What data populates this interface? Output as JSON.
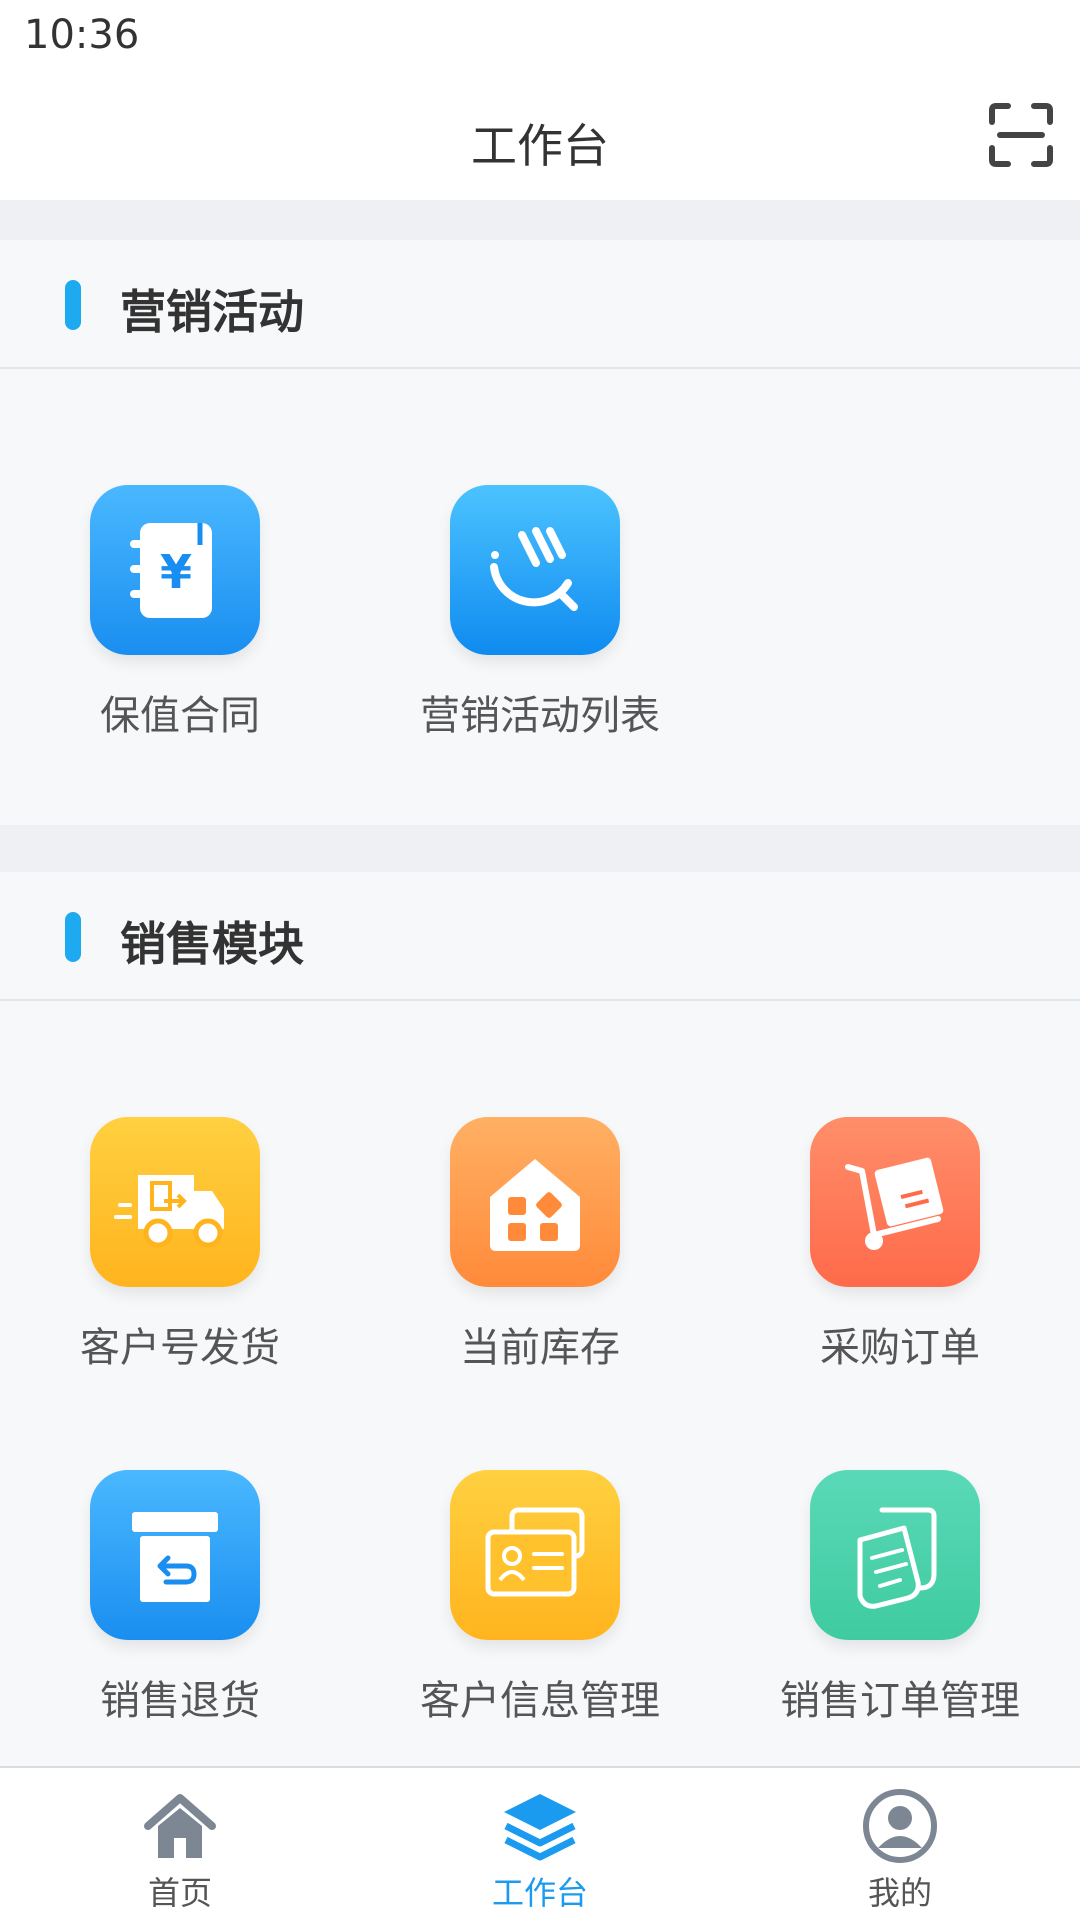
{
  "status_bar": {
    "time": "10:36"
  },
  "header": {
    "title": "工作台",
    "scan_icon": "scan-icon"
  },
  "sections": [
    {
      "title": "营销活动",
      "items": [
        {
          "label": "保值合同",
          "icon": "contract-yen-icon",
          "color": "#2a9df4"
        },
        {
          "label": "营销活动列表",
          "icon": "marketing-activity-icon",
          "color": "#1a9af2"
        }
      ]
    },
    {
      "title": "销售模块",
      "items": [
        {
          "label": "客户号发货",
          "icon": "delivery-truck-icon",
          "color": "#ffc22d"
        },
        {
          "label": "当前库存",
          "icon": "warehouse-icon",
          "color": "#ff9d4d"
        },
        {
          "label": "采购订单",
          "icon": "purchase-cart-icon",
          "color": "#ff7a5c"
        },
        {
          "label": "销售退货",
          "icon": "return-box-icon",
          "color": "#2a9df4"
        },
        {
          "label": "客户信息管理",
          "icon": "customer-card-icon",
          "color": "#ffc22d"
        },
        {
          "label": "销售订单管理",
          "icon": "sales-order-icon",
          "color": "#4fd3ad"
        }
      ]
    }
  ],
  "tabbar": {
    "items": [
      {
        "label": "首页",
        "icon": "home-icon",
        "active": false
      },
      {
        "label": "工作台",
        "icon": "layers-icon",
        "active": true
      },
      {
        "label": "我的",
        "icon": "profile-icon",
        "active": false
      }
    ],
    "active_color": "#1b9bf0"
  }
}
